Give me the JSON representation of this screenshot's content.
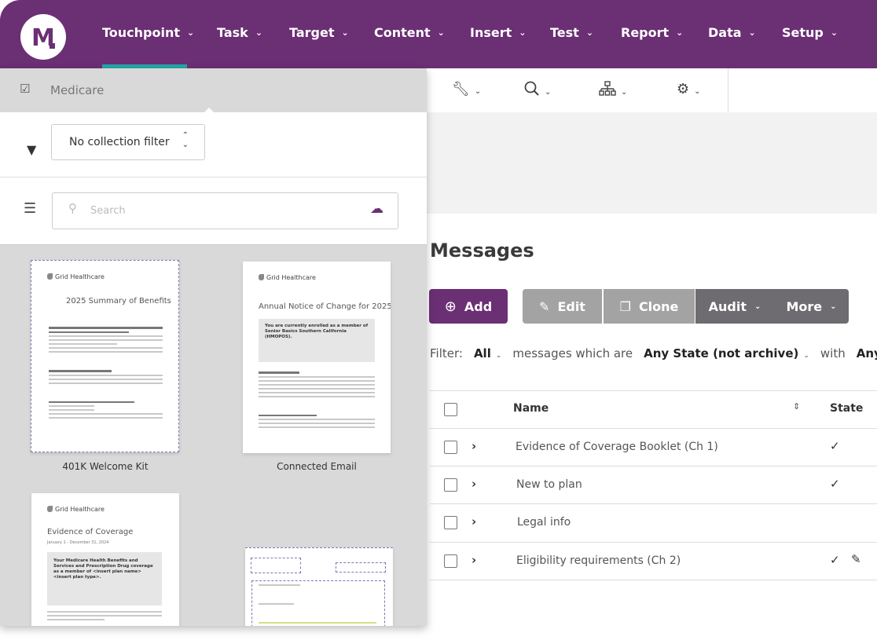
{
  "nav": {
    "items": [
      "Touchpoint",
      "Task",
      "Target",
      "Content",
      "Insert",
      "Test",
      "Report",
      "Data",
      "Setup"
    ],
    "active": "Touchpoint"
  },
  "panel": {
    "header": "Medicare",
    "collection_filter": "No collection filter",
    "search_placeholder": "Search",
    "docs": [
      {
        "label": "401K Welcome Kit",
        "brand": "Grid Healthcare",
        "title": "2025 Summary of Benefits"
      },
      {
        "label": "Connected Email",
        "brand": "Grid Healthcare",
        "title": "Annual Notice of Change for 2025",
        "callout": "You are currently enrolled as a member of Senior Basics Southern California (HMOPOS)."
      },
      {
        "label": "",
        "brand": "Grid Healthcare",
        "title": "Evidence of Coverage",
        "subtitle": "January 1 - December 31, 2024",
        "callout": "Your Medicare Health Benefits and Services and Prescription Drug coverage as a member of <insert plan name><insert plan type>."
      },
      {
        "label": ""
      }
    ]
  },
  "main": {
    "title": "Messages",
    "buttons": {
      "add": "Add",
      "edit": "Edit",
      "clone": "Clone",
      "audit": "Audit",
      "more": "More"
    },
    "filter": {
      "label": "Filter:",
      "scope": "All",
      "text1": "messages which are",
      "state": "Any State (not archive)",
      "text2": "with",
      "any": "Any"
    },
    "table": {
      "columns": {
        "name": "Name",
        "state": "State"
      },
      "rows": [
        {
          "name": "Evidence of Coverage Booklet (Ch 1)",
          "state": "✓"
        },
        {
          "name": "New to plan",
          "state": "✓"
        },
        {
          "name": "Legal info",
          "state": ""
        },
        {
          "name": "Eligibility requirements (Ch 2)",
          "state": "✓"
        }
      ]
    }
  },
  "colors": {
    "brand": "#6b2f74",
    "accent": "#26a6a6",
    "button_gray": "#a3a3a3",
    "button_dark": "#6e6c70"
  }
}
